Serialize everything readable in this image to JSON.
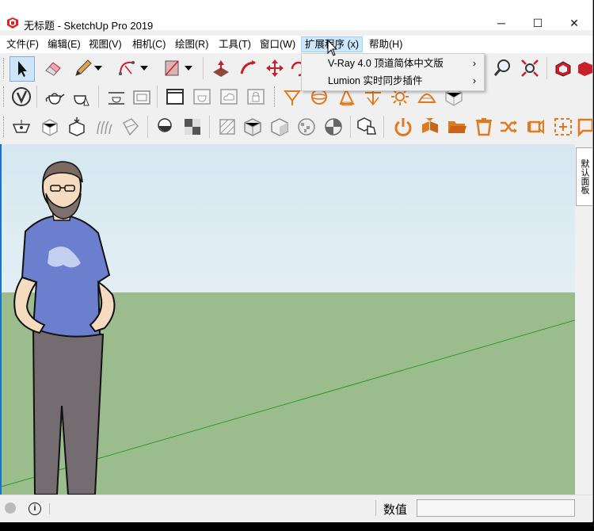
{
  "window": {
    "title": "无标题 - SketchUp Pro 2019",
    "minimize_glyph": "─",
    "maximize_glyph": "☐",
    "close_glyph": "✕"
  },
  "menubar": {
    "items": [
      {
        "label": "文件(F)"
      },
      {
        "label": "编辑(E)"
      },
      {
        "label": "视图(V)"
      },
      {
        "label": "相机(C)"
      },
      {
        "label": "绘图(R)"
      },
      {
        "label": "工具(T)"
      },
      {
        "label": "窗口(W)"
      },
      {
        "label": "扩展程序 (x)"
      },
      {
        "label": "帮助(H)"
      }
    ],
    "active_index": 7
  },
  "extensions_menu": {
    "items": [
      {
        "label": "V-Ray 4.0 顶道简体中文版",
        "arrow": "›"
      },
      {
        "label": "Lumion 实时同步插件",
        "arrow": "›"
      }
    ]
  },
  "right_tray": {
    "tab_label": "默认面板"
  },
  "statusbar": {
    "measurements_label": "数值",
    "measurements_value": ""
  },
  "colors": {
    "accent_orange": "#e07a1f",
    "accent_red": "#c8202a",
    "sky": "#dce9f2",
    "ground": "#9bbd8e",
    "axis_green": "#2a9a2a",
    "menu_highlight": "#cce8ff"
  }
}
